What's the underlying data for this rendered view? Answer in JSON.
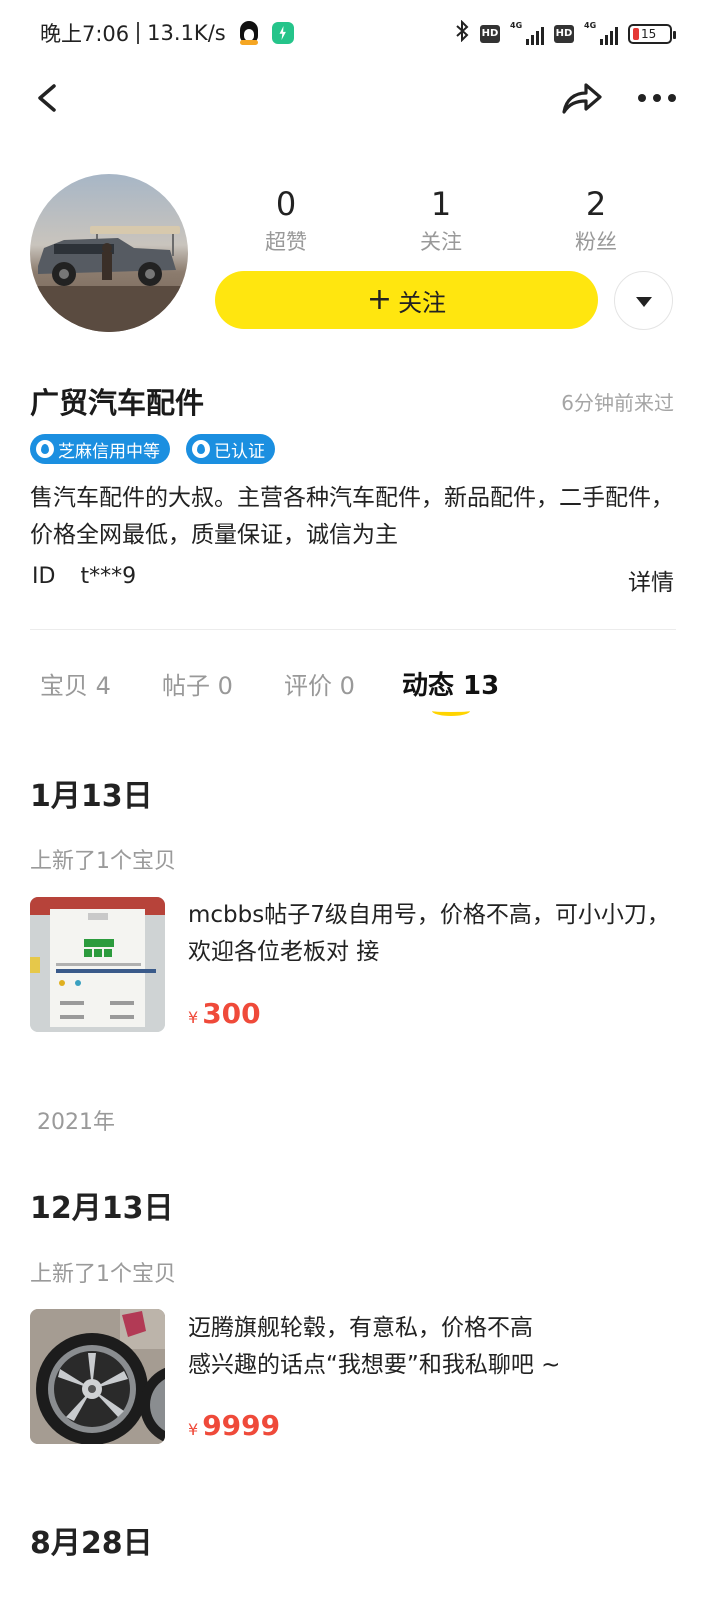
{
  "status_bar": {
    "time": "晚上7:06",
    "net_speed": "13.1K/s",
    "hd1": "HD",
    "hd2": "HD",
    "net1": "4G",
    "net2": "4G",
    "battery": "15"
  },
  "profile": {
    "stats": [
      {
        "value": "0",
        "label": "超赞"
      },
      {
        "value": "1",
        "label": "关注"
      },
      {
        "value": "2",
        "label": "粉丝"
      }
    ],
    "follow_label": "关注",
    "name": "广贸汽车配件",
    "last_seen": "6分钟前来过",
    "badges": [
      "芝麻信用中等",
      "已认证"
    ],
    "bio": "售汽车配件的大叔。主营各种汽车配件，新品配件，二手配件，价格全网最低，质量保证，诚信为主",
    "id_label": "ID",
    "id_value": "t***9",
    "details_label": "详情"
  },
  "tabs": [
    {
      "label": "宝贝 4"
    },
    {
      "label": "帖子 0"
    },
    {
      "label": "评价 0"
    },
    {
      "label": "动态 13",
      "active": true
    }
  ],
  "timeline": {
    "group1": {
      "date": "1月13日",
      "action": "上新了1个宝贝",
      "title": "mcbbs帖子7级自用号，价格不高，可小小刀，欢迎各位老板对 接",
      "currency": "¥",
      "price": "300"
    },
    "year": "2021年",
    "group2": {
      "date": "12月13日",
      "action": "上新了1个宝贝",
      "title_line1": "迈腾旗舰轮毂，有意私，价格不高",
      "title_line2": "感兴趣的话点“我想要”和我私聊吧 ~",
      "currency": "¥",
      "price": "9999"
    },
    "group3": {
      "date": "8月28日"
    }
  },
  "colors": {
    "accent_yellow": "#ffe60f",
    "price_red": "#ef4a3a",
    "badge_blue": "#1b8fe0"
  }
}
